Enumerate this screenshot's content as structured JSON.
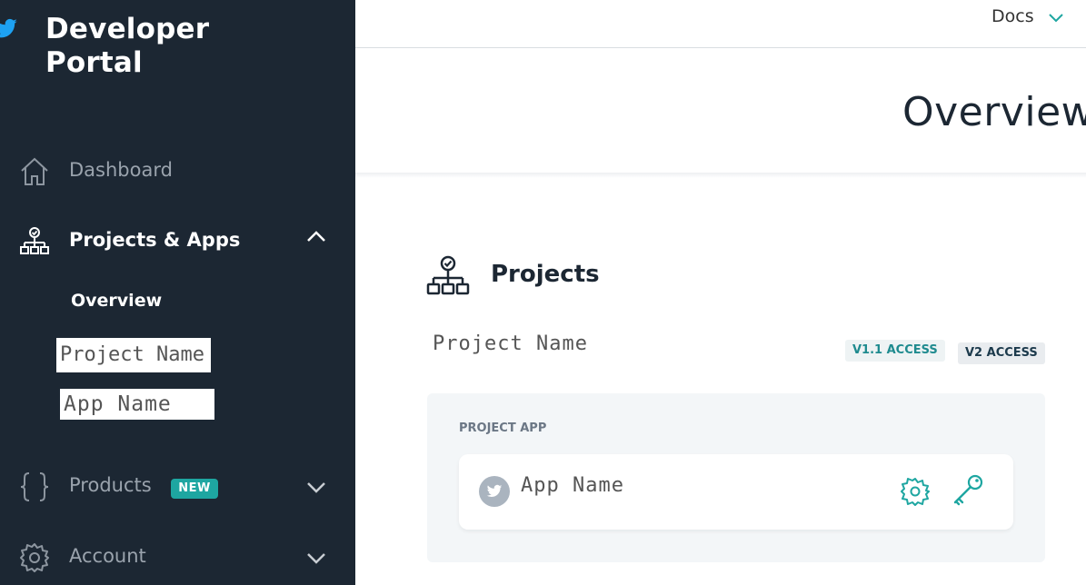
{
  "sidebar": {
    "brand_title": "Developer Portal",
    "nav": {
      "dashboard": "Dashboard",
      "projects_apps": "Projects & Apps",
      "overview": "Overview",
      "project_name": "Project Name",
      "app_name": "App Name",
      "products": "Products",
      "products_badge": "NEW",
      "account": "Account"
    }
  },
  "topbar": {
    "docs_label": "Docs"
  },
  "main": {
    "page_title": "Overview",
    "projects_heading": "Projects",
    "project_name": "Project Name",
    "access_badges": [
      "V1.1 ACCESS",
      "V2 ACCESS"
    ],
    "project_app_label": "PROJECT APP",
    "app_name": "App Name"
  },
  "colors": {
    "sidebar_bg": "#1c2733",
    "accent_teal": "#1ea6a1",
    "inactive_text": "#9aa3ad"
  },
  "icons": [
    "twitter-bird-icon",
    "home-icon",
    "projects-tree-icon",
    "chevron-up-icon",
    "braces-icon",
    "chevron-down-icon",
    "gear-icon",
    "key-icon"
  ]
}
